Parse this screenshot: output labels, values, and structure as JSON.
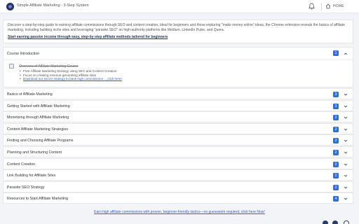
{
  "app": {
    "title": "Simple Affiliate Marketing - 3-Step System",
    "home_label": "HOME"
  },
  "intro": {
    "text": "Discover a step-by-step guide to earning affiliate commissions through SEO and content creation. Ideal for beginners and those exploring \"make money online\" ideas, the Chrome extension reveals the basics of affiliate marketing, including building niche sites and leveraging \"parasite SEO\" on high-authority platforms like Medium, LinkedIn Pulse, and Quora.",
    "cta": "Start earning passive income through easy, step-by-step affiliate methods tailored for beginners"
  },
  "course_intro": {
    "label": "Course Introduction",
    "count": "1",
    "lesson": "Overview of Affiliate Marketing Course",
    "bullets": [
      "Free Affiliate Marketing Strategy using SEO and Content Creation",
      "Focus on creating revenue-generating affiliate sites",
      "Download our secret strategy to bank high commissions ... click here!"
    ]
  },
  "sections": [
    {
      "label": "Basics of Affiliate Marketing",
      "count": "3"
    },
    {
      "label": "Getting Started with Affiliate Marketing",
      "count": "3"
    },
    {
      "label": "Monetizing through Affiliate Marketing",
      "count": "2"
    },
    {
      "label": "Content Affiliate Marketing Strategies",
      "count": "2"
    },
    {
      "label": "Finding and Choosing Affiliate Programs",
      "count": "2"
    },
    {
      "label": "Planning and Structuring Content",
      "count": "2"
    },
    {
      "label": "Content Creation",
      "count": "2"
    },
    {
      "label": "Link Building for Affiliate Sites",
      "count": "2"
    },
    {
      "label": "Parasite SEO Strategy",
      "count": "2"
    },
    {
      "label": "Resources to Start Affiliate Marketing",
      "count": "4"
    }
  ],
  "footer": {
    "link": "Earn high affiliate commissions with proven, beginner-friendly tactics—no guesswork required, click here Now!"
  },
  "colors": {
    "accent": "#2f6fd6",
    "brand": "#23335c",
    "link": "#2f5fd6"
  },
  "icons": [
    "logo-icon",
    "bell-icon",
    "home-icon",
    "chevron-up-icon",
    "chevron-down-icon",
    "checkbox-icon",
    "facebook-icon",
    "pinterest-icon",
    "reddit-icon"
  ]
}
